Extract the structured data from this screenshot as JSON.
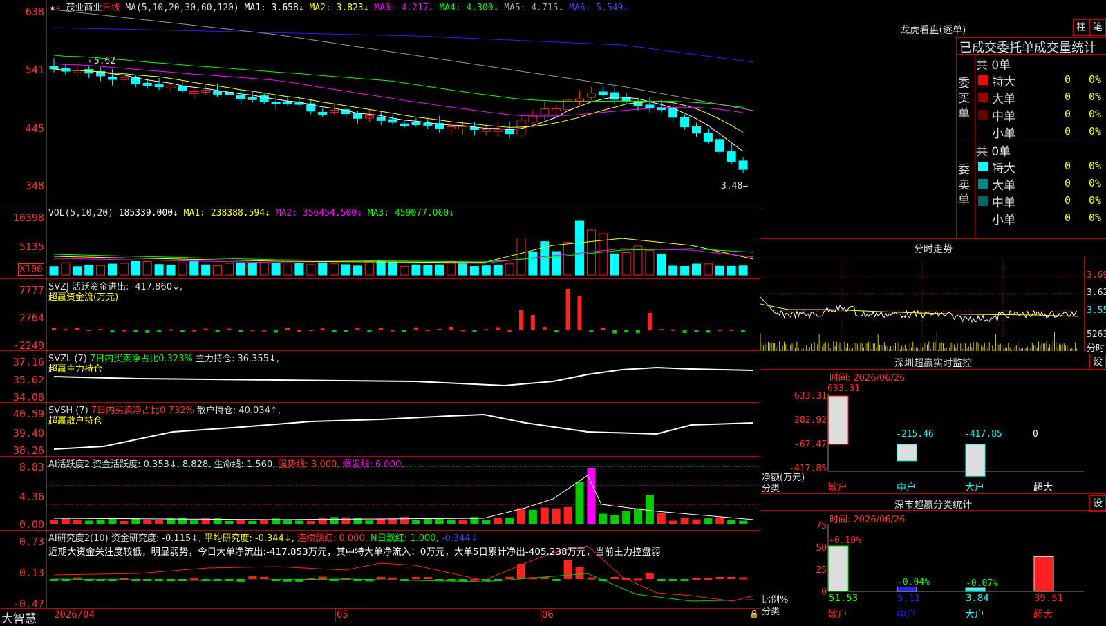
{
  "app": {
    "name": "大智慧",
    "date_label": "2026/04"
  },
  "colors": {
    "up": "#ff2020",
    "down": "#00ffff",
    "grid": "#c00000",
    "ma1": "#ffffff",
    "ma2": "#ffff00",
    "ma3": "#ff00ff",
    "ma4": "#00ff00",
    "ma5": "#888888",
    "ma6": "#2222ff"
  },
  "price_panel": {
    "stock": "茂业商业",
    "period": "日线",
    "ma_head": "MA(5,10,20,30,60,120)",
    "ma1": "MA1: 3.658↓",
    "ma2": "MA2: 3.823↓",
    "ma3": "MA3: 4.217↓",
    "ma4": "MA4: 4.300↓",
    "ma5": "MA5: 4.715↓",
    "ma6": "MA6: 5.549↓",
    "y_ticks": [
      "638",
      "541",
      "445",
      "348"
    ],
    "high_label": "5.62",
    "low_label": "3.48"
  },
  "vol_panel": {
    "head": "VOL(5,10,20)",
    "val": "185339.000↓",
    "ma1": "MA1: 238388.594↓",
    "ma2": "MA2: 356454.500↓",
    "ma3": "MA3: 459077.000↓",
    "y_ticks": [
      "10398",
      "5135"
    ],
    "unit": "X100"
  },
  "svzj_panel": {
    "head": "SVZJ  活跃资金进出: -417.860↓,",
    "sub": "超赢资金流(万元)",
    "y_ticks": [
      "7777",
      "2764",
      "-2249"
    ]
  },
  "svzl_panel": {
    "head": "SVZL (7)",
    "ratio": "7日内买卖净占比0.323%",
    "hold": "主力持仓: 36.355↓,",
    "sub": "超赢主力持仓",
    "y_ticks": [
      "37.16",
      "35.62",
      "34.08"
    ]
  },
  "svsh_panel": {
    "head": "SVSH (7)",
    "ratio": "7日内买卖净占比0.732%",
    "hold": "散户持仓: 40.034↑,",
    "sub": "超赢散户持仓",
    "y_ticks": [
      "40.59",
      "39.40",
      "38.26"
    ]
  },
  "ai1_panel": {
    "head": "AI活跃度2 资金活跃度: 0.353↓, 8.828, 生命线: 1.560,",
    "strong": "强势线: 3.000,",
    "burst": "爆发线: 6.000,",
    "y_ticks": [
      "8.83",
      "4.36",
      "0.00"
    ]
  },
  "ai2_panel": {
    "head": "AI研究度2(10) 资金研究度: -0.115↓,",
    "avg": "平均研究度: -0.344↓,",
    "red": "连续飘红: 0.000,",
    "nred": "N日飘红: 1.000,",
    "last": "-0.344↓",
    "comment": "近期大资金关注度较低，明显弱势，今日大单净流出:-417.853万元，其中特大单净流入：0万元，大单5日累计净出-405.238万元，当前主力控盘弱",
    "y_ticks": [
      "0.73",
      "0.13",
      "-0.47"
    ]
  },
  "x_axis": {
    "labels": [
      "2026/04",
      "05",
      "06"
    ]
  },
  "dragon": {
    "title": "龙虎看盘(逐单)",
    "btn_bar": "柱",
    "btn_pen": "笔",
    "heading": "已成交委托单成交量统计",
    "buy_label": "委买单",
    "sell_label": "委卖单",
    "buy_total": "共 0单",
    "sell_total": "共 0单",
    "buy_rows": [
      {
        "name": "特大",
        "count": "0",
        "pct": "0%",
        "color": "#ff0000"
      },
      {
        "name": "大单",
        "count": "0",
        "pct": "0%",
        "color": "#990000"
      },
      {
        "name": "中单",
        "count": "0",
        "pct": "0%",
        "color": "#660000"
      },
      {
        "name": "小单",
        "count": "0",
        "pct": "0%",
        "color": "#000000"
      }
    ],
    "sell_rows": [
      {
        "name": "特大",
        "count": "0",
        "pct": "0%",
        "color": "#00ffff"
      },
      {
        "name": "大单",
        "count": "0",
        "pct": "0%",
        "color": "#008888"
      },
      {
        "name": "中单",
        "count": "0",
        "pct": "0%",
        "color": "#006666"
      },
      {
        "name": "小单",
        "count": "0",
        "pct": "0%",
        "color": "#000000"
      }
    ]
  },
  "intraday": {
    "title": "分时走势",
    "y_ticks": [
      "3.690",
      "3.620",
      "3.550"
    ],
    "vol_tick": "5263",
    "vol_unit": "分时"
  },
  "monitor": {
    "title": "深圳超赢实时监控",
    "settings": "设",
    "time": "时间: 2026/06/26",
    "y_ticks": [
      "633.31",
      "282.92",
      "-67.47",
      "-417.85"
    ],
    "y_label": "净额(万元)",
    "x_title": "分类",
    "categories": [
      "散户",
      "中户",
      "大户",
      "超大"
    ],
    "values_text": [
      "633.31",
      "-215.46",
      "-417.85",
      "0"
    ],
    "values": [
      633.31,
      -215.46,
      -417.85,
      0
    ]
  },
  "classify": {
    "title": "深市超赢分类统计",
    "settings": "设",
    "time": "时间: 2026/06/26",
    "y_ticks": [
      "75",
      "50",
      "25",
      "0"
    ],
    "y_label": "比例%",
    "x_title": "分类",
    "categories": [
      "散户",
      "中户",
      "大户",
      "超大"
    ],
    "bottom_vals": [
      "51.53",
      "5.11",
      "3.84",
      "39.51"
    ],
    "top_vals": [
      "+0.10%",
      "-0.04%",
      "-0.07%",
      ""
    ],
    "values": [
      51.53,
      5.11,
      3.84,
      39.51
    ]
  }
}
